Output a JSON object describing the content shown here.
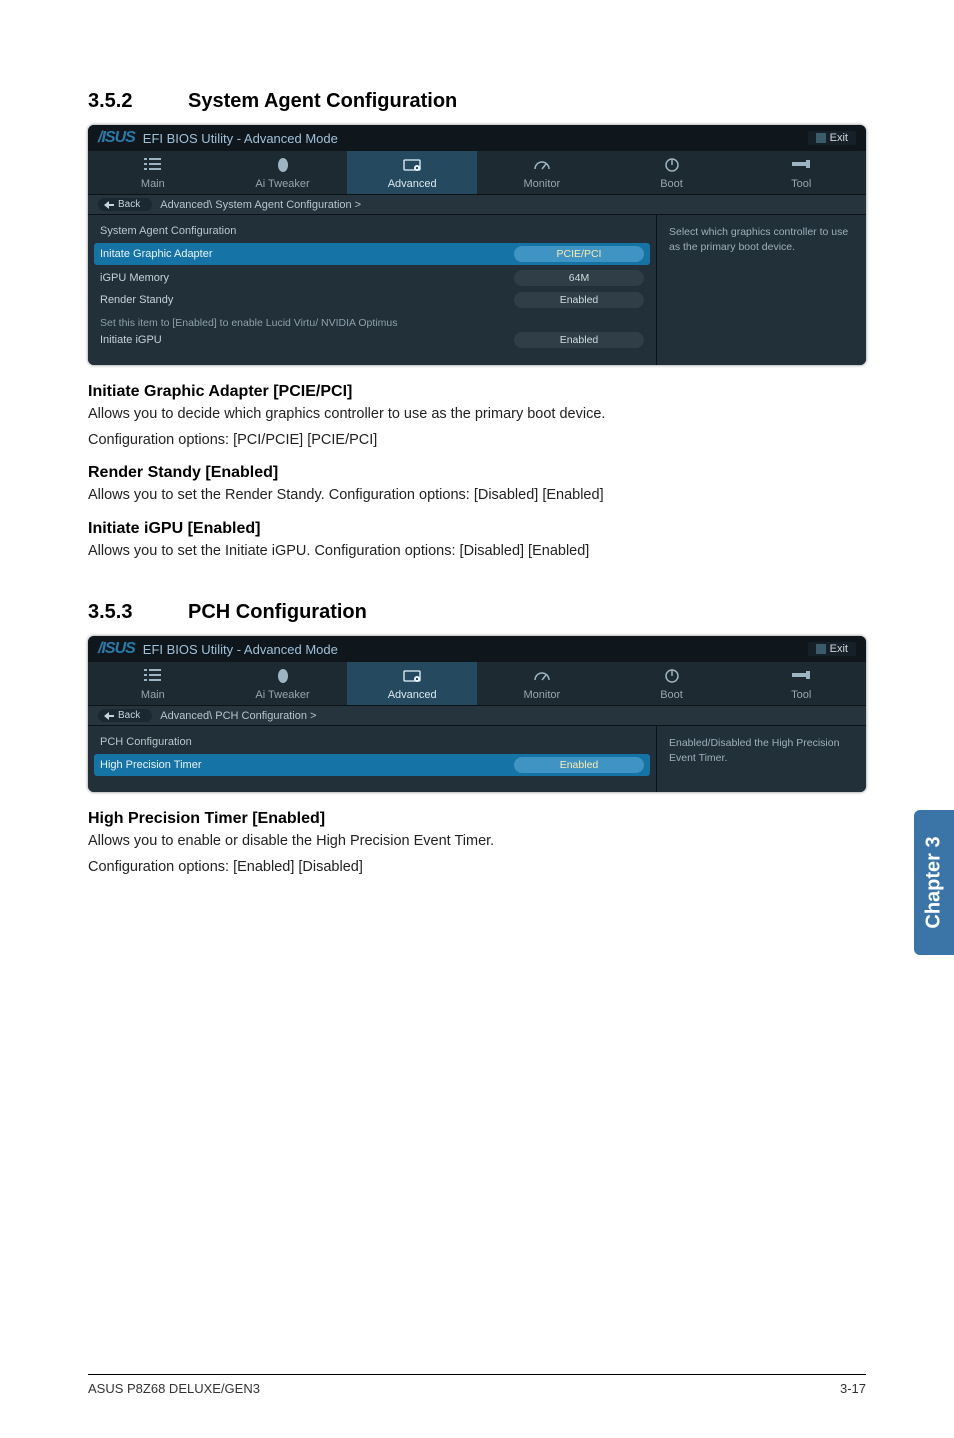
{
  "section1": {
    "num": "3.5.2",
    "title": "System Agent Configuration",
    "bios": {
      "header_title": "EFI BIOS Utility - Advanced Mode",
      "exit": "Exit",
      "tabs": {
        "main": "Main",
        "ai": "Ai  Tweaker",
        "adv": "Advanced",
        "mon": "Monitor",
        "boot": "Boot",
        "tool": "Tool"
      },
      "back": "Back",
      "breadcrumb": "Advanced\\  System Agent Configuration  >",
      "config_title": "System Agent Configuration",
      "rows": {
        "r1": {
          "label": "Initate Graphic Adapter",
          "value": "PCIE/PCI"
        },
        "r2": {
          "label": "iGPU Memory",
          "value": "64M"
        },
        "r3": {
          "label": "Render Standy",
          "value": "Enabled"
        },
        "note": "Set this item to [Enabled] to enable Lucid Virtu/ NVIDIA Optimus",
        "r4": {
          "label": "Initiate iGPU",
          "value": "Enabled"
        }
      },
      "help": "Select which graphics controller to use as the primary boot device."
    },
    "items": {
      "i1": {
        "heading": "Initiate Graphic Adapter [PCIE/PCI]",
        "p1": "Allows you to decide which graphics controller to use as the primary boot device.",
        "p2": "Configuration options: [PCI/PCIE] [PCIE/PCI]"
      },
      "i2": {
        "heading": "Render Standy [Enabled]",
        "p1": "Allows you to set the Render Standy. Configuration options: [Disabled] [Enabled]"
      },
      "i3": {
        "heading": "Initiate iGPU [Enabled]",
        "p1": "Allows you to set the Initiate iGPU. Configuration options: [Disabled] [Enabled]"
      }
    }
  },
  "section2": {
    "num": "3.5.3",
    "title": "PCH Configuration",
    "bios": {
      "header_title": "EFI BIOS Utility - Advanced Mode",
      "exit": "Exit",
      "tabs": {
        "main": "Main",
        "ai": "Ai  Tweaker",
        "adv": "Advanced",
        "mon": "Monitor",
        "boot": "Boot",
        "tool": "Tool"
      },
      "back": "Back",
      "breadcrumb": "Advanced\\  PCH Configuration  >",
      "config_title": "PCH Configuration",
      "rows": {
        "r1": {
          "label": "High Precision Timer",
          "value": "Enabled"
        }
      },
      "help": "Enabled/Disabled the High Precision Event Timer."
    },
    "items": {
      "i1": {
        "heading": "High Precision Timer [Enabled]",
        "p1": "Allows you to enable or disable the High Precision Event Timer.",
        "p2": "Configuration options: [Enabled] [Disabled]"
      }
    }
  },
  "chapter_tab": "Chapter 3",
  "footer": {
    "left": "ASUS P8Z68 DELUXE/GEN3",
    "right": "3-17"
  }
}
